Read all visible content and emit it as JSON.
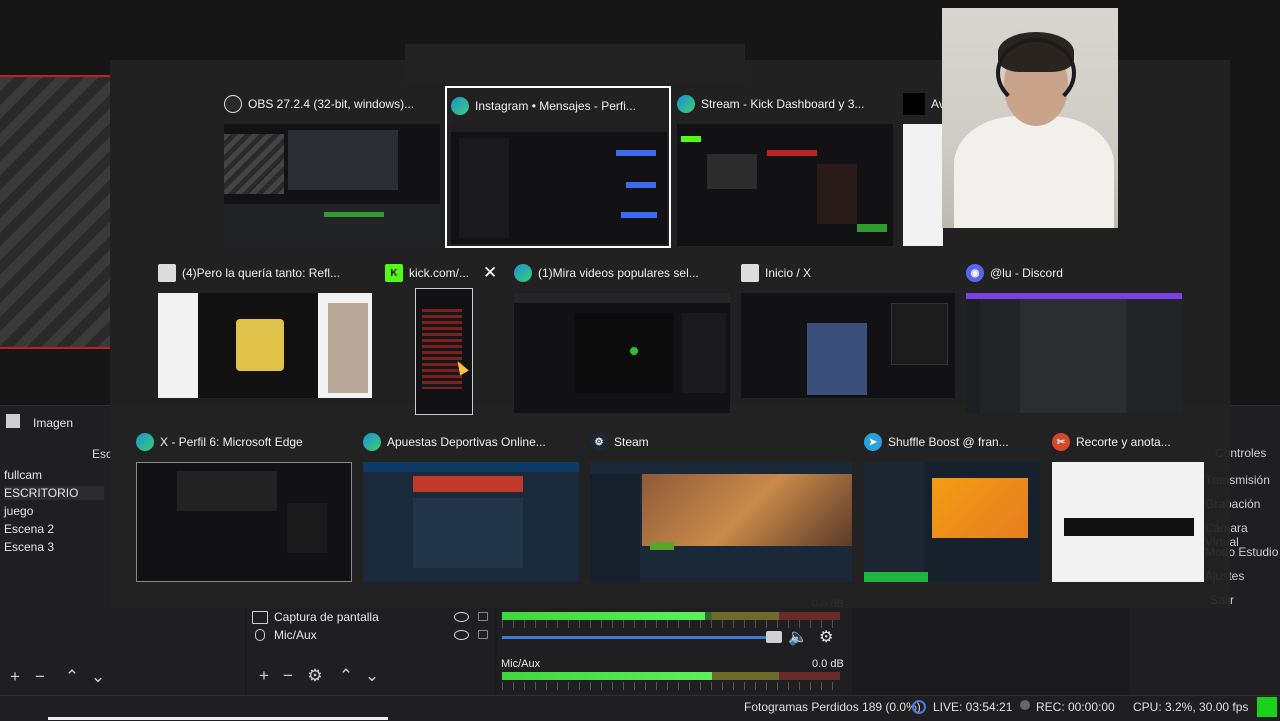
{
  "obs": {
    "scenes_panel_label": "Esc",
    "scenes": [
      "fullcam",
      "ESCRITORIO",
      "juego",
      "Escena 2",
      "Escena 3"
    ],
    "active_scene_index": 1,
    "image_source_label": "Imagen",
    "sources": [
      {
        "name": "Captura de pantalla",
        "icon": "monitor-icon"
      },
      {
        "name": "Mic/Aux",
        "icon": "mic-icon"
      }
    ],
    "mixer": {
      "top_value": "0.0 dB",
      "mic_label": "Mic/Aux",
      "mic_value": "0.0 dB",
      "mic_level": 0.62,
      "volume_level": 1.0
    },
    "controls_label": "Controles",
    "controls": [
      "Transmisión",
      "Grabación",
      "Cámara Virtual",
      "Modo Estudio",
      "Ajustes",
      "Salir"
    ],
    "status": {
      "dropped_frames": "Fotogramas Perdidos 189 (0.0%)",
      "live": "LIVE: 03:54:21",
      "rec": "REC: 00:00:00",
      "cpu": "CPU: 3.2%, 30.00 fps"
    },
    "colors": {
      "accent": "#3a7bd5",
      "status_ok": "#1cd01c",
      "hatch_border": "#bb2222"
    }
  },
  "switcher": {
    "rows": [
      [
        {
          "title": "OBS 27.2.4 (32-bit, windows)...",
          "icon": "obs-icon",
          "theme": "dark",
          "selected": false
        },
        {
          "title": "Instagram • Mensajes - Perfi...",
          "icon": "edge-icon",
          "theme": "dark",
          "selected": true
        },
        {
          "title": "Stream - Kick Dashboard y 3...",
          "icon": "edge-icon",
          "theme": "dark",
          "selected": false
        },
        {
          "title": "Av",
          "icon": "black-square-icon",
          "theme": "light",
          "selected": false
        }
      ],
      [
        {
          "title": "(4)Pero la quería tanto: Refl...",
          "icon": "app-window-icon",
          "theme": "light",
          "selected": false
        },
        {
          "title": "kick.com/...",
          "icon": "kick-icon",
          "theme": "light",
          "selected": false,
          "closable": true
        },
        {
          "title": "(1)Mira videos populares sel...",
          "icon": "edge-icon",
          "theme": "dark",
          "selected": false
        },
        {
          "title": "Inicio / X",
          "icon": "app-window-icon",
          "theme": "dark",
          "selected": false
        },
        {
          "title": "@lu - Discord",
          "icon": "discord-icon",
          "theme": "dark",
          "selected": false
        }
      ],
      [
        {
          "title": "X - Perfil 6: Microsoft Edge",
          "icon": "edge-icon",
          "theme": "dark",
          "selected": false
        },
        {
          "title": "Apuestas Deportivas Online...",
          "icon": "edge-icon",
          "theme": "dark",
          "selected": false
        },
        {
          "title": "Steam",
          "icon": "steam-icon",
          "theme": "dark",
          "selected": false
        },
        {
          "title": "Shuffle Boost @ fran...",
          "icon": "telegram-icon",
          "theme": "dark",
          "selected": false
        },
        {
          "title": "Recorte y anota...",
          "icon": "snipping-tool-icon",
          "theme": "light",
          "selected": false
        }
      ]
    ],
    "close_glyph": "✕"
  }
}
